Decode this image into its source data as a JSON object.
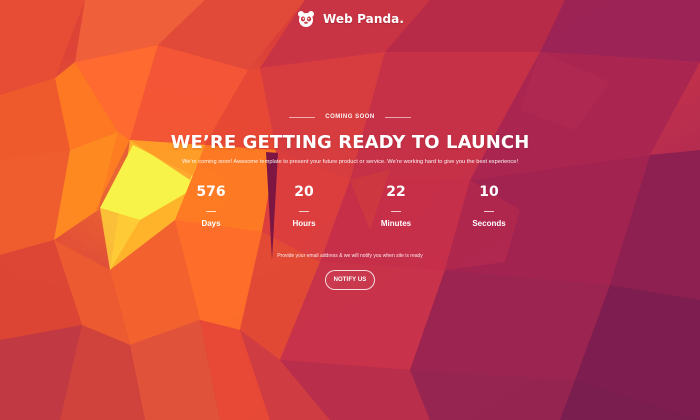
{
  "brand": {
    "name": "Web Panda."
  },
  "hero": {
    "eyebrow": "COMING SOON",
    "title": "WE’RE GETTING READY TO LAUNCH",
    "description": "We’re coming soon! Awesome template to present your future product or service. We’re working hard to give you the best experience!"
  },
  "countdown": {
    "days": {
      "value": "576",
      "label": "Days"
    },
    "hours": {
      "value": "20",
      "label": "Hours"
    },
    "minutes": {
      "value": "22",
      "label": "Minutes"
    },
    "seconds": {
      "value": "10",
      "label": "Seconds"
    }
  },
  "notify": {
    "text": "Provide your email address & we will notify you when site is ready",
    "button_label": "NOTIFY US"
  },
  "icons": {
    "brand": "panda-icon"
  },
  "colors": {
    "background_primary": "#b52f45",
    "background_orange": "#ff7b21",
    "background_yellow": "#f8f64a",
    "background_purple": "#7e1d4f",
    "text": "#ffffff"
  }
}
